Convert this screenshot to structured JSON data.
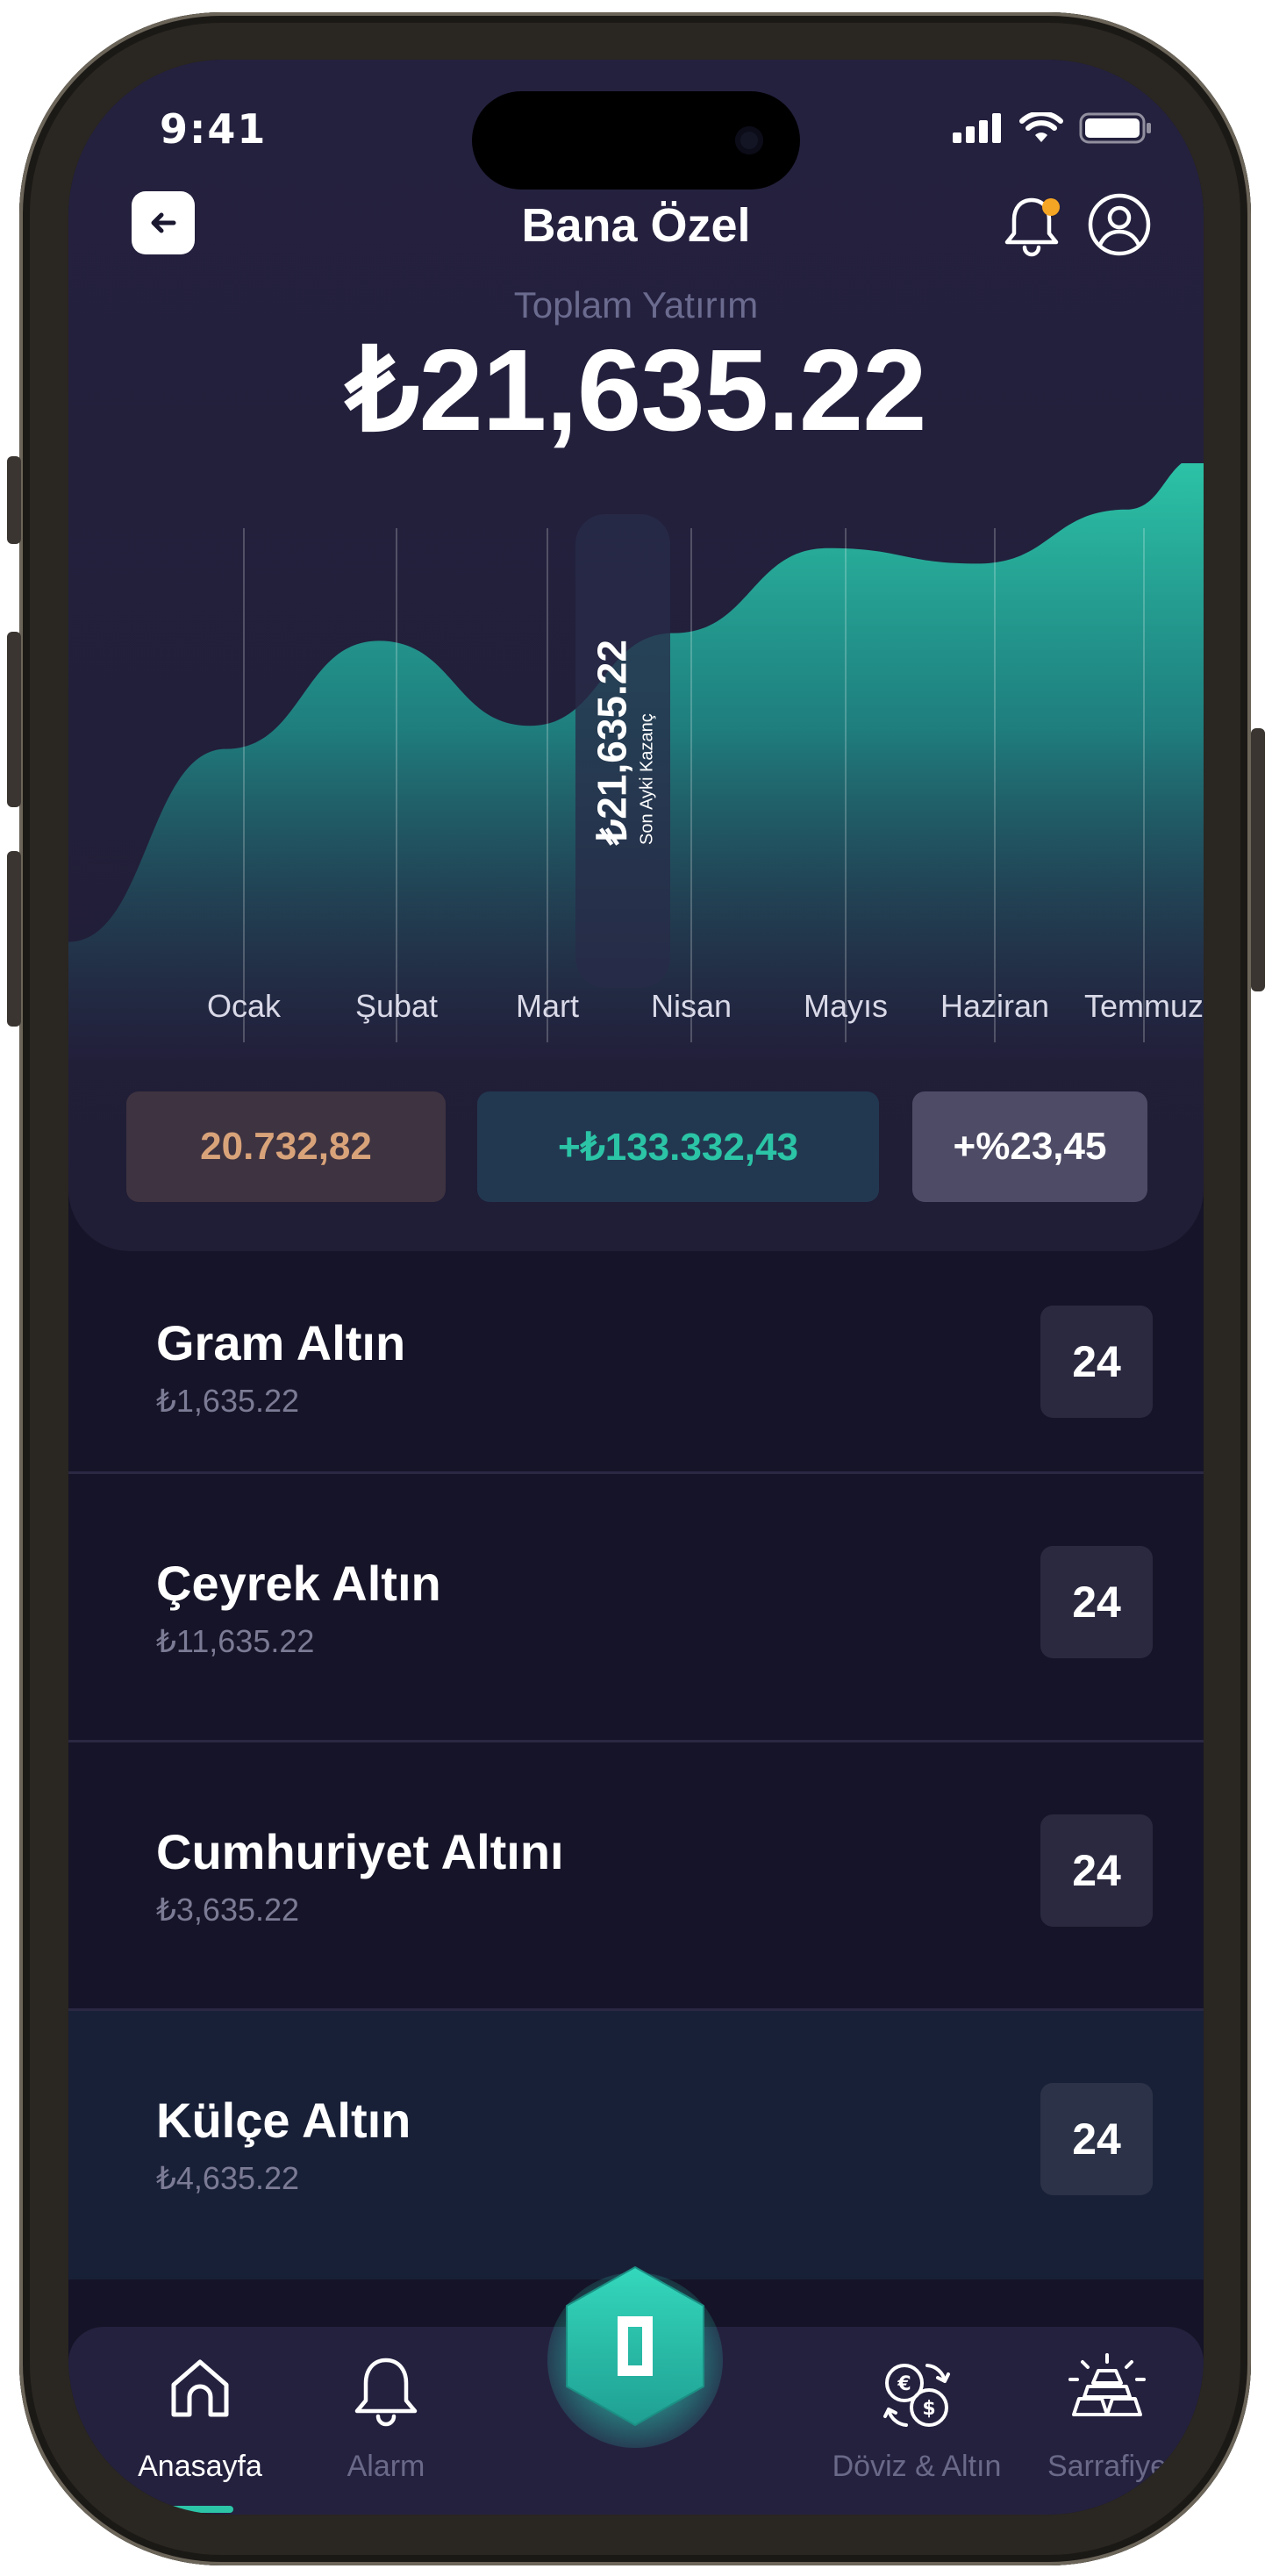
{
  "status_bar": {
    "time": "9:41"
  },
  "header": {
    "title": "Bana Özel"
  },
  "summary": {
    "label": "Toplam Yatırım",
    "value": "₺21,635.22"
  },
  "chart_data": {
    "type": "area",
    "categories": [
      "Ocak",
      "Şubat",
      "Mart",
      "Nisan",
      "Mayıs",
      "Haziran",
      "Temmuz"
    ],
    "series": [
      {
        "values": [
          18800,
          20200,
          19100,
          20300,
          21400,
          21200,
          21900
        ]
      }
    ],
    "tooltip": {
      "category": "Nisan",
      "value": "₺21,635.22",
      "caption": "Son Ayki Kazanç"
    },
    "colors": {
      "fill_top": "#2cc5a8",
      "fill_bottom": "#24213f"
    },
    "grid": true
  },
  "stats": {
    "amount": "20.732,82",
    "gain": "+₺133.332,43",
    "percent": "+%23,45"
  },
  "items": [
    {
      "title": "Gram Altın",
      "price": "₺1,635.22",
      "badge": "24"
    },
    {
      "title": "Çeyrek Altın",
      "price": "₺11,635.22",
      "badge": "24"
    },
    {
      "title": "Cumhuriyet Altını",
      "price": "₺3,635.22",
      "badge": "24"
    },
    {
      "title": "Külçe Altın",
      "price": "₺4,635.22",
      "badge": "24"
    }
  ],
  "nav": {
    "home": "Anasayfa",
    "alarm": "Alarm",
    "exchange": "Döviz & Altın",
    "jeweler": "Sarrafiye"
  },
  "colors": {
    "accent": "#2cc5a8",
    "background": "#151327",
    "panel": "#24213f",
    "notification_dot": "#f5a524"
  }
}
